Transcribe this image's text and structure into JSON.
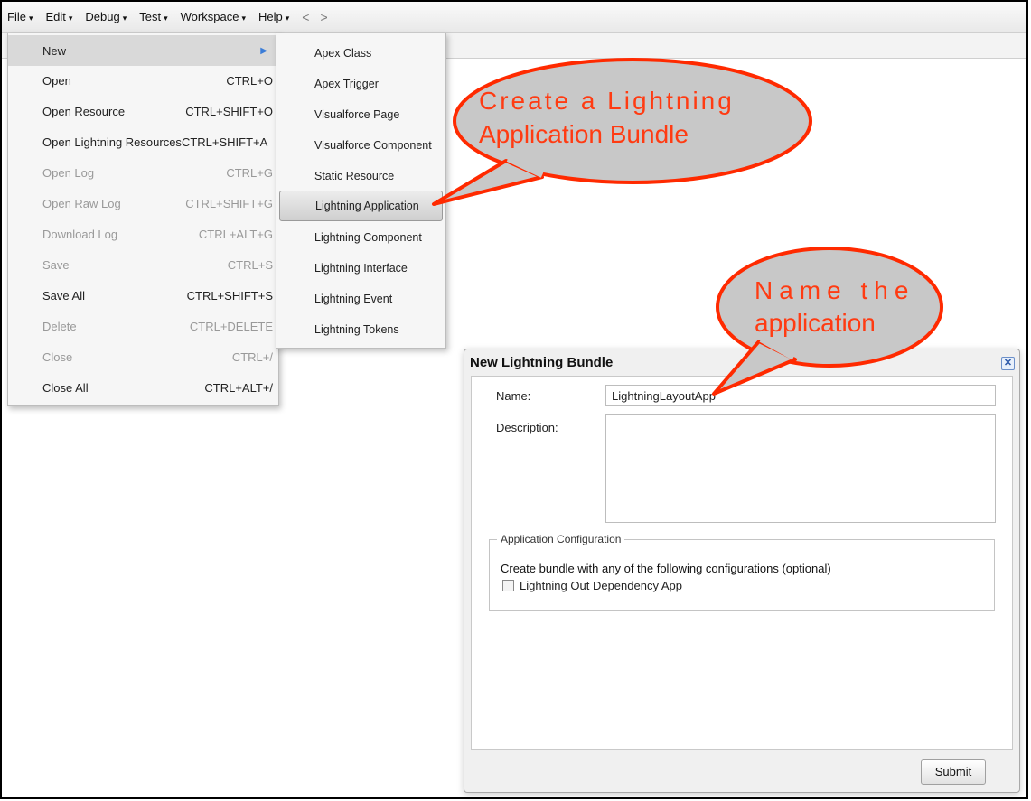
{
  "menubar": {
    "items": [
      {
        "label": "File",
        "caret": "▾"
      },
      {
        "label": "Edit",
        "caret": "▾"
      },
      {
        "label": "Debug",
        "caret": "▾"
      },
      {
        "label": "Test",
        "caret": "▾"
      },
      {
        "label": "Workspace",
        "caret": "▾"
      },
      {
        "label": "Help",
        "caret": "▾"
      }
    ],
    "back": "<",
    "forward": ">"
  },
  "file_menu": {
    "items": [
      {
        "label": "New",
        "shortcut": "",
        "state": "selected",
        "submenu_icon": "triangle-right-icon"
      },
      {
        "label": "Open",
        "shortcut": "CTRL+O",
        "state": "enabled"
      },
      {
        "label": "Open Resource",
        "shortcut": "CTRL+SHIFT+O",
        "state": "enabled"
      },
      {
        "label": "Open Lightning Resources",
        "shortcut": "CTRL+SHIFT+A",
        "state": "enabled"
      },
      {
        "label": "Open Log",
        "shortcut": "CTRL+G",
        "state": "disabled"
      },
      {
        "label": "Open Raw Log",
        "shortcut": "CTRL+SHIFT+G",
        "state": "disabled"
      },
      {
        "label": "Download Log",
        "shortcut": "CTRL+ALT+G",
        "state": "disabled"
      },
      {
        "label": "Save",
        "shortcut": "CTRL+S",
        "state": "disabled"
      },
      {
        "label": "Save All",
        "shortcut": "CTRL+SHIFT+S",
        "state": "enabled"
      },
      {
        "label": "Delete",
        "shortcut": "CTRL+DELETE",
        "state": "disabled"
      },
      {
        "label": "Close",
        "shortcut": "CTRL+/",
        "state": "disabled"
      },
      {
        "label": "Close All",
        "shortcut": "CTRL+ALT+/",
        "state": "enabled"
      }
    ]
  },
  "new_submenu": {
    "items": [
      {
        "label": "Apex Class"
      },
      {
        "label": "Apex Trigger"
      },
      {
        "label": "Visualforce Page"
      },
      {
        "label": "Visualforce Component"
      },
      {
        "label": "Static Resource"
      },
      {
        "label": "Lightning Application",
        "highlighted": true
      },
      {
        "label": "Lightning Component"
      },
      {
        "label": "Lightning Interface"
      },
      {
        "label": "Lightning Event"
      },
      {
        "label": "Lightning Tokens"
      }
    ]
  },
  "dialog": {
    "title": "New Lightning Bundle",
    "close_icon": "close-icon",
    "name_label": "Name:",
    "name_value": "LightningLayoutApp",
    "description_label": "Description:",
    "description_value": "",
    "config_legend": "Application Configuration",
    "config_note": "Create bundle with any of the following configurations (optional)",
    "checkbox_label": "Lightning Out Dependency App",
    "checkbox_checked": false,
    "submit_label": "Submit"
  },
  "callouts": {
    "create": {
      "line1": "Create a Lightning",
      "line2": "Application Bundle"
    },
    "name": {
      "line1": "Name the",
      "line2": "application"
    }
  },
  "colors": {
    "callout_text": "#ff3b12",
    "callout_border": "#ff2a00",
    "callout_fill": "#c8c8c8"
  }
}
